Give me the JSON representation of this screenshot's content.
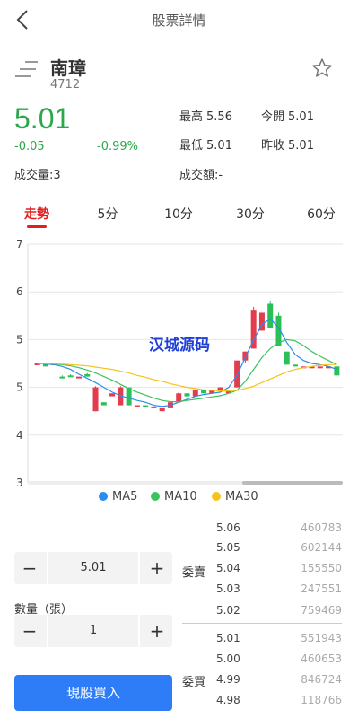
{
  "nav": {
    "title": "股票詳情"
  },
  "stock": {
    "name": "南璋",
    "code": "4712",
    "price": "5.01",
    "change": "-0.05",
    "change_pct": "-0.99%",
    "volume": "成交量:3",
    "high_label": "最高",
    "high": "5.56",
    "open_label": "今開",
    "open": "5.01",
    "low_label": "最低",
    "low": "5.01",
    "prev_label": "昨收",
    "prev": "5.01",
    "turnover": "成交額:-"
  },
  "tabs": [
    {
      "label": "走勢",
      "active": true
    },
    {
      "label": "5分"
    },
    {
      "label": "10分"
    },
    {
      "label": "30分"
    },
    {
      "label": "60分"
    }
  ],
  "colors": {
    "up": "#e23c4e",
    "down": "#2bbf58",
    "ma5": "#2b8cf0",
    "ma10": "#3cc25e",
    "ma30": "#f6c21b",
    "price_green": "#2aa84a",
    "accent_red": "#e02020",
    "buy_blue": "#2e7cf6"
  },
  "watermark": "汉城源码",
  "chart_data": {
    "type": "candlestick",
    "y_ticks": [
      "7",
      "6",
      "5",
      "5",
      "4",
      "3"
    ],
    "ylim": [
      3,
      7
    ],
    "candles": [
      {
        "o": 5.0,
        "c": 5.0,
        "h": 5.0,
        "l": 5.0
      },
      {
        "o": 5.0,
        "c": 4.95,
        "h": 5.0,
        "l": 4.95
      },
      {
        "o": 5.0,
        "c": 5.0,
        "h": 5.0,
        "l": 5.0
      },
      {
        "o": 4.78,
        "c": 4.75,
        "h": 4.8,
        "l": 4.75
      },
      {
        "o": 4.8,
        "c": 4.78,
        "h": 4.82,
        "l": 4.78
      },
      {
        "o": 4.78,
        "c": 4.78,
        "h": 4.78,
        "l": 4.78
      },
      {
        "o": 4.82,
        "c": 4.78,
        "h": 4.84,
        "l": 4.78
      },
      {
        "o": 4.2,
        "c": 4.6,
        "h": 4.62,
        "l": 4.2
      },
      {
        "o": 4.35,
        "c": 4.3,
        "h": 4.35,
        "l": 4.3
      },
      {
        "o": 4.45,
        "c": 4.5,
        "h": 4.5,
        "l": 4.45
      },
      {
        "o": 4.3,
        "c": 4.6,
        "h": 4.62,
        "l": 4.3
      },
      {
        "o": 4.6,
        "c": 4.3,
        "h": 4.6,
        "l": 4.3
      },
      {
        "o": 4.3,
        "c": 4.3,
        "h": 4.3,
        "l": 4.3
      },
      {
        "o": 4.3,
        "c": 4.28,
        "h": 4.3,
        "l": 4.28
      },
      {
        "o": 4.28,
        "c": 4.28,
        "h": 4.28,
        "l": 4.28
      },
      {
        "o": 4.2,
        "c": 4.25,
        "h": 4.25,
        "l": 4.2
      },
      {
        "o": 4.25,
        "c": 4.35,
        "h": 4.35,
        "l": 4.25
      },
      {
        "o": 4.35,
        "c": 4.5,
        "h": 4.52,
        "l": 4.35
      },
      {
        "o": 4.5,
        "c": 4.45,
        "h": 4.5,
        "l": 4.45
      },
      {
        "o": 4.45,
        "c": 4.55,
        "h": 4.55,
        "l": 4.45
      },
      {
        "o": 4.55,
        "c": 4.5,
        "h": 4.55,
        "l": 4.5
      },
      {
        "o": 4.5,
        "c": 4.55,
        "h": 4.55,
        "l": 4.5
      },
      {
        "o": 4.55,
        "c": 4.6,
        "h": 4.6,
        "l": 4.55
      },
      {
        "o": 4.5,
        "c": 4.55,
        "h": 4.55,
        "l": 4.5
      },
      {
        "o": 4.6,
        "c": 5.05,
        "h": 5.05,
        "l": 4.6
      },
      {
        "o": 5.05,
        "c": 5.2,
        "h": 5.2,
        "l": 5.0
      },
      {
        "o": 5.25,
        "c": 5.9,
        "h": 5.95,
        "l": 5.25
      },
      {
        "o": 5.55,
        "c": 5.85,
        "h": 5.85,
        "l": 5.55
      },
      {
        "o": 6.0,
        "c": 5.6,
        "h": 6.05,
        "l": 5.6
      },
      {
        "o": 5.8,
        "c": 5.3,
        "h": 5.85,
        "l": 5.3
      },
      {
        "o": 5.2,
        "c": 4.98,
        "h": 5.2,
        "l": 4.98
      },
      {
        "o": 4.98,
        "c": 4.95,
        "h": 4.98,
        "l": 4.95
      },
      {
        "o": 4.95,
        "c": 4.95,
        "h": 4.95,
        "l": 4.95
      },
      {
        "o": 4.95,
        "c": 4.95,
        "h": 4.95,
        "l": 4.95
      },
      {
        "o": 4.95,
        "c": 4.95,
        "h": 4.95,
        "l": 4.95
      },
      {
        "o": 4.95,
        "c": 4.95,
        "h": 4.95,
        "l": 4.95
      },
      {
        "o": 4.95,
        "c": 4.8,
        "h": 4.95,
        "l": 4.8
      }
    ],
    "series": [
      {
        "name": "MA5",
        "values": [
          5.0,
          4.99,
          4.98,
          4.95,
          4.9,
          4.82,
          4.75,
          4.68,
          4.6,
          4.52,
          4.46,
          4.42,
          4.38,
          4.35,
          4.3,
          4.28,
          4.3,
          4.35,
          4.4,
          4.45,
          4.48,
          4.5,
          4.52,
          4.6,
          4.8,
          5.1,
          5.4,
          5.65,
          5.75,
          5.6,
          5.35,
          5.15,
          5.05,
          5.0,
          4.98,
          4.95,
          4.9
        ]
      },
      {
        "name": "MA10",
        "values": [
          5.0,
          5.0,
          4.99,
          4.98,
          4.96,
          4.93,
          4.89,
          4.84,
          4.78,
          4.72,
          4.65,
          4.58,
          4.52,
          4.47,
          4.42,
          4.38,
          4.36,
          4.36,
          4.38,
          4.4,
          4.42,
          4.44,
          4.46,
          4.5,
          4.55,
          4.7,
          4.9,
          5.1,
          5.25,
          5.35,
          5.4,
          5.38,
          5.3,
          5.2,
          5.12,
          5.05,
          4.98
        ]
      },
      {
        "name": "MA30",
        "values": [
          5.0,
          5.0,
          5.0,
          4.99,
          4.98,
          4.97,
          4.96,
          4.94,
          4.92,
          4.9,
          4.87,
          4.84,
          4.8,
          4.77,
          4.73,
          4.7,
          4.66,
          4.63,
          4.6,
          4.58,
          4.56,
          4.55,
          4.54,
          4.54,
          4.55,
          4.58,
          4.62,
          4.68,
          4.74,
          4.8,
          4.86,
          4.9,
          4.93,
          4.95,
          4.97,
          4.98,
          4.98
        ]
      }
    ]
  },
  "trade": {
    "price_value": "5.01",
    "qty_label": "數量（張）",
    "qty_value": "1",
    "minus": "−",
    "plus": "+",
    "buy_label": "現股買入"
  },
  "orderbook": {
    "ask_label": "委賣",
    "bid_label": "委買",
    "asks": [
      {
        "price": "5.06",
        "qty": "460783"
      },
      {
        "price": "5.05",
        "qty": "602144"
      },
      {
        "price": "5.04",
        "qty": "155550"
      },
      {
        "price": "5.03",
        "qty": "247551"
      },
      {
        "price": "5.02",
        "qty": "759469"
      }
    ],
    "bids": [
      {
        "price": "5.01",
        "qty": "551943"
      },
      {
        "price": "5.00",
        "qty": "460653"
      },
      {
        "price": "4.99",
        "qty": "846724"
      },
      {
        "price": "4.98",
        "qty": "118766"
      }
    ]
  }
}
